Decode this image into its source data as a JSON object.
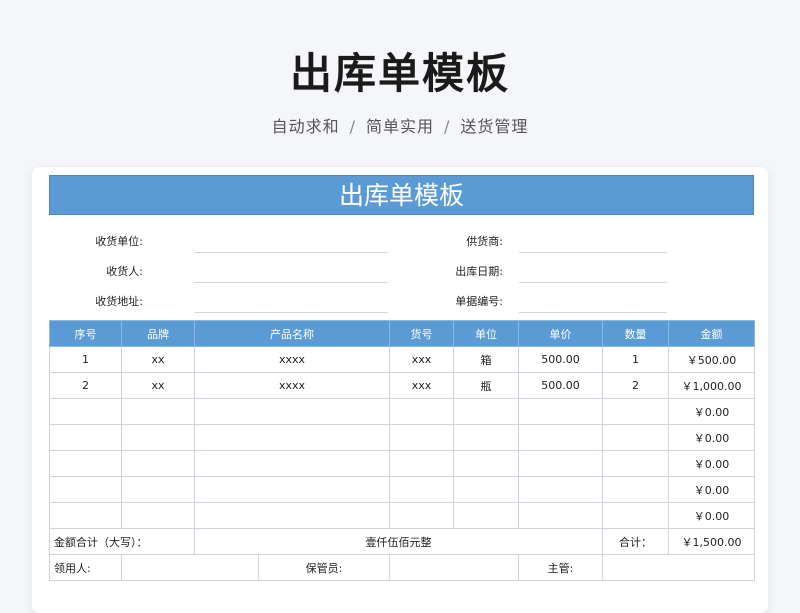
{
  "page": {
    "title": "出库单模板",
    "subtitle_parts": [
      "自动求和",
      "简单实用",
      "送货管理"
    ],
    "subtitle_sep": "/"
  },
  "form": {
    "banner_title": "出库单模板",
    "fields_left": [
      {
        "label": "收货单位:",
        "value": ""
      },
      {
        "label": "收货人:",
        "value": ""
      },
      {
        "label": "收货地址:",
        "value": ""
      }
    ],
    "fields_right": [
      {
        "label": "供货商:",
        "value": ""
      },
      {
        "label": "出库日期:",
        "value": ""
      },
      {
        "label": "单据编号:",
        "value": ""
      }
    ],
    "columns": [
      "序号",
      "品牌",
      "产品名称",
      "货号",
      "单位",
      "单价",
      "数量",
      "金额"
    ],
    "rows": [
      [
        "1",
        "xx",
        "xxxx",
        "xxx",
        "箱",
        "500.00",
        "1",
        "￥500.00"
      ],
      [
        "2",
        "xx",
        "xxxx",
        "xxx",
        "瓶",
        "500.00",
        "2",
        "￥1,000.00"
      ],
      [
        "",
        "",
        "",
        "",
        "",
        "",
        "",
        "￥0.00"
      ],
      [
        "",
        "",
        "",
        "",
        "",
        "",
        "",
        "￥0.00"
      ],
      [
        "",
        "",
        "",
        "",
        "",
        "",
        "",
        "￥0.00"
      ],
      [
        "",
        "",
        "",
        "",
        "",
        "",
        "",
        "￥0.00"
      ],
      [
        "",
        "",
        "",
        "",
        "",
        "",
        "",
        "￥0.00"
      ]
    ],
    "total_words_label": "金额合计（大写）：",
    "total_words": "壹仟伍佰元整",
    "total_label": "合计：",
    "total_value": "￥1,500.00",
    "footer": {
      "receiver_label": "领用人:",
      "keeper_label": "保管员:",
      "supervisor_label": "主管:"
    }
  }
}
